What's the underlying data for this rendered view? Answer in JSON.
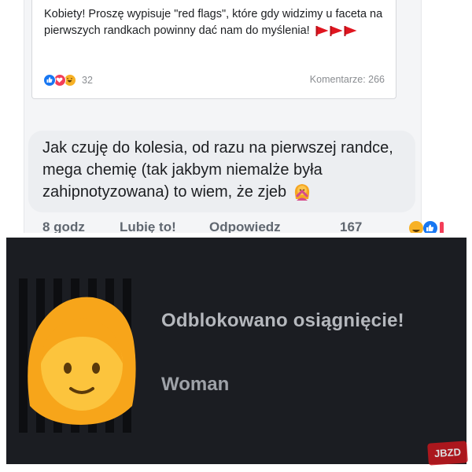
{
  "post": {
    "text": "Kobiety! Proszę wypisuje \"red flags\", które gdy widzimy u faceta na pierwszych randkach powinny dać nam do myślenia!",
    "reaction_count": "32",
    "comments_label": "Komentarze: 266",
    "reaction_icons": [
      "like-icon",
      "love-icon",
      "haha-icon"
    ],
    "flag_icons": [
      "red-flag-icon",
      "red-flag-icon",
      "red-flag-icon"
    ]
  },
  "comment": {
    "text": "Jak czuję do kolesia, od razu na pierwszej randce, mega chemię (tak jakbym niemalże była zahipnotyzowana) to wiem, że zjeb",
    "emoji": "woman-gesturing-no-icon",
    "time": "8 godz",
    "like_action": "Lubię to!",
    "reply_action": "Odpowiedz",
    "reaction_count": "167"
  },
  "achievement": {
    "title": "Odblokowano osiągnięcie!",
    "name": "Woman",
    "icon": "woman-emoji-icon"
  },
  "watermark": {
    "text": "JBZD"
  },
  "colors": {
    "facebook_blue": "#1877f2",
    "red_flag": "#e0151f",
    "achievement_bg": "#1b1d22"
  }
}
